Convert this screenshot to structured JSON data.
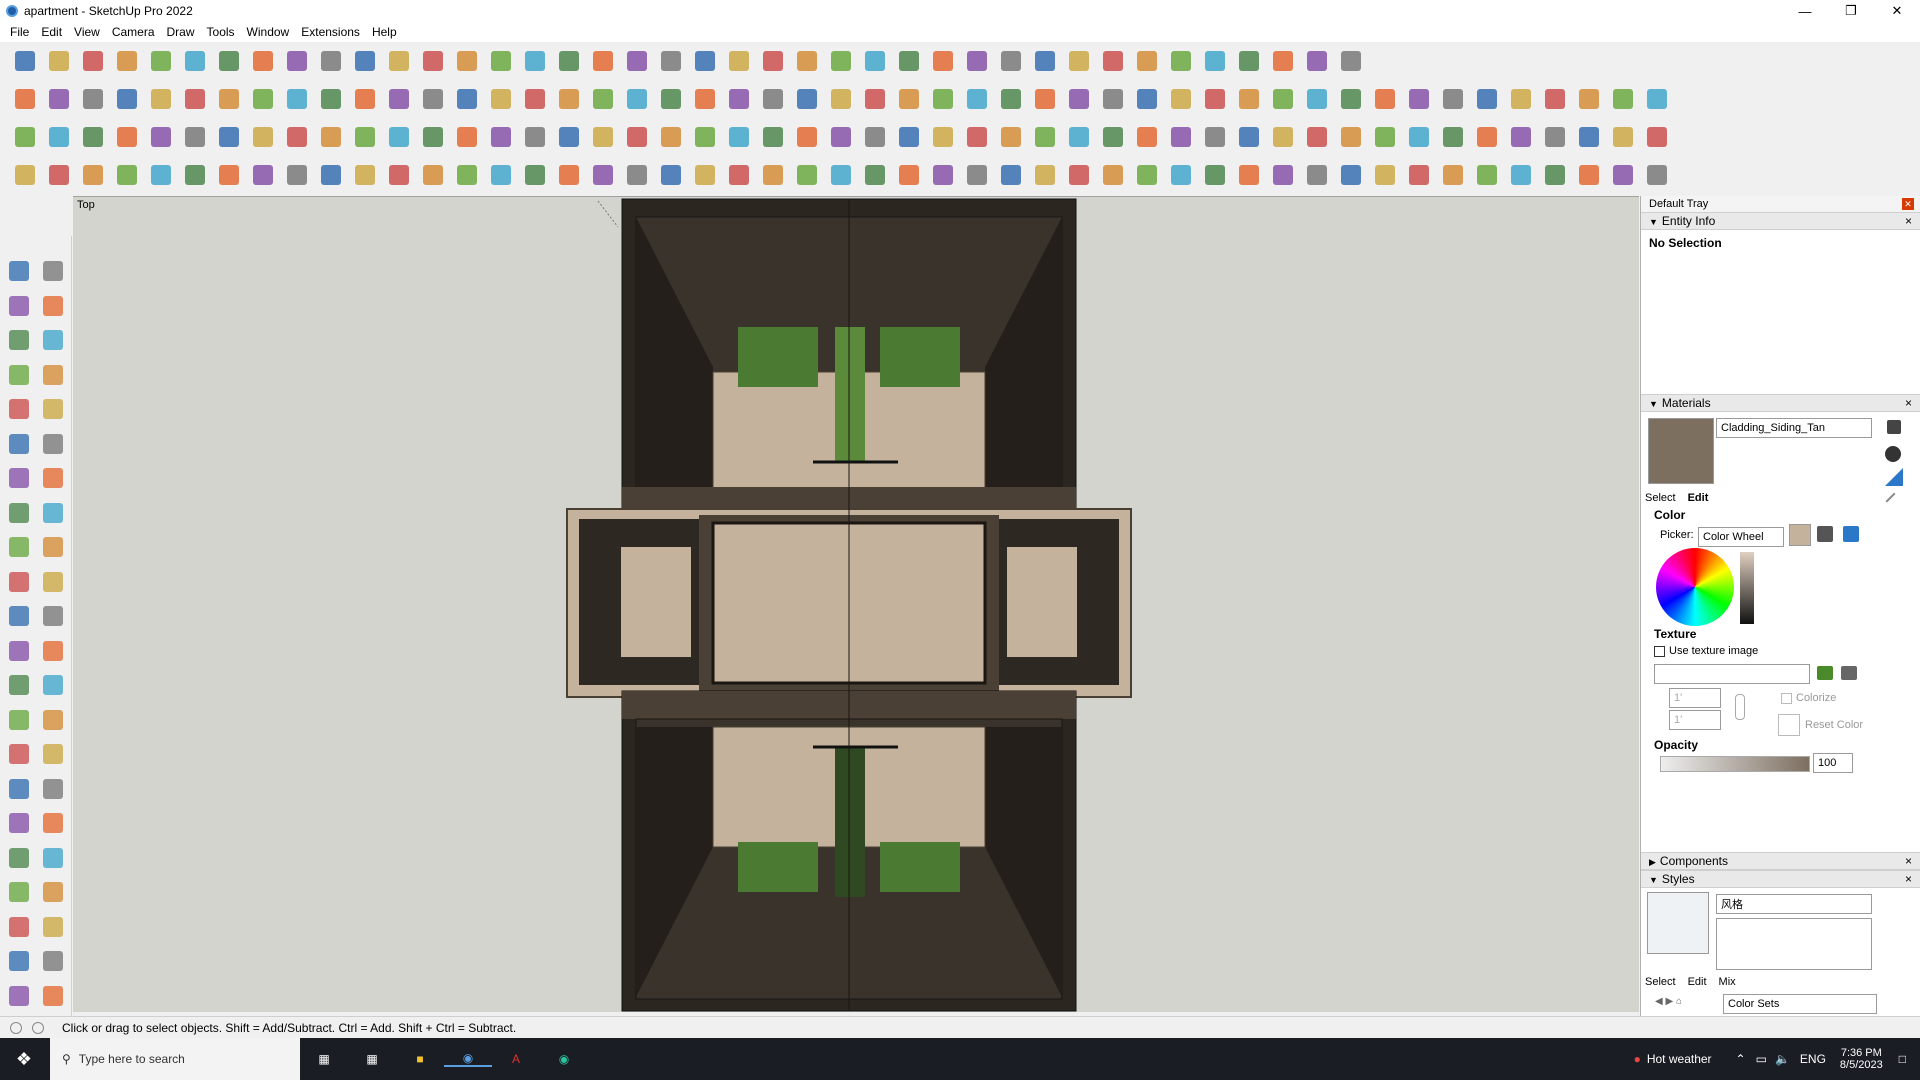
{
  "window": {
    "title": "apartment - SketchUp Pro 2022"
  },
  "menu": [
    "File",
    "Edit",
    "View",
    "Camera",
    "Draw",
    "Tools",
    "Window",
    "Extensions",
    "Help"
  ],
  "viewport": {
    "label": "Top"
  },
  "tray": {
    "title": "Default Tray",
    "entity_info": {
      "header": "Entity Info",
      "status": "No Selection"
    },
    "materials": {
      "header": "Materials",
      "name": "Cladding_Siding_Tan",
      "tabs": [
        "Select",
        "Edit"
      ],
      "color_label": "Color",
      "picker_label": "Picker:",
      "picker_value": "Color Wheel",
      "texture_label": "Texture",
      "use_texture": "Use texture image",
      "size_w": "1'",
      "size_h": "1'",
      "colorize": "Colorize",
      "reset_color": "Reset Color",
      "opacity_label": "Opacity",
      "opacity_value": "100",
      "swatch_color": "#7d6f60"
    },
    "components": {
      "header": "Components"
    },
    "styles": {
      "header": "Styles",
      "name": "风格",
      "tabs": [
        "Select",
        "Edit",
        "Mix"
      ],
      "collection": "Color Sets"
    }
  },
  "status": {
    "text": "Click or drag to select objects. Shift = Add/Subtract. Ctrl = Add. Shift + Ctrl = Subtract."
  },
  "taskbar": {
    "search_placeholder": "Type here to search",
    "weather": "Hot weather",
    "language": "ENG",
    "time": "7:36 PM",
    "date": "8/5/2023"
  },
  "colors": {
    "accent": "#d83b01",
    "toolbar_bg": "#f0f0f0",
    "model_dark": "#2b2620",
    "model_tan": "#c4b29c",
    "grass": "#5a8a3a"
  }
}
